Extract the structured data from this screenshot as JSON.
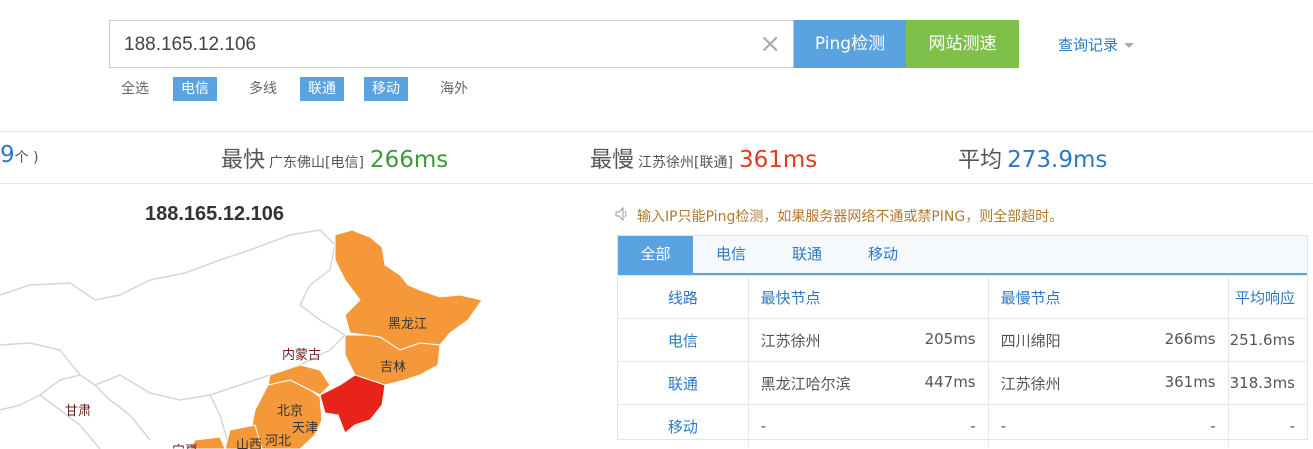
{
  "search": {
    "value": "188.165.12.106",
    "clear": "×"
  },
  "buttons": {
    "ping": "Ping检测",
    "speed": "网站测速"
  },
  "history": {
    "label": "查询记录"
  },
  "carriers": [
    {
      "label": "全选",
      "active": false
    },
    {
      "label": "电信",
      "active": true
    },
    {
      "label": "多线",
      "active": false
    },
    {
      "label": "联通",
      "active": true
    },
    {
      "label": "移动",
      "active": true
    },
    {
      "label": "海外",
      "active": false
    }
  ],
  "stats": {
    "count_fragment": "9",
    "count_unit": "个 )",
    "fastest": {
      "label": "最快",
      "location": "广东佛山[电信]",
      "value": "266ms"
    },
    "slowest": {
      "label": "最慢",
      "location": "江苏徐州[联通]",
      "value": "361ms"
    },
    "average": {
      "label": "平均",
      "value": "273.9ms"
    }
  },
  "map": {
    "title": "188.165.12.106",
    "labels": {
      "heilongjiang": "黑龙江",
      "jilin": "吉林",
      "neimenggu": "内蒙古",
      "gansu": "甘肃",
      "beijing": "北京",
      "tianjin": "天津",
      "hebei": "河北",
      "shanxi": "山西",
      "ningxia": "宁夏"
    }
  },
  "notice": {
    "icon": "speaker-icon",
    "text": "输入IP只能Ping检测，如果服务器网络不通或禁PING，则全部超时。"
  },
  "table": {
    "tabs": [
      "全部",
      "电信",
      "联通",
      "移动"
    ],
    "headers": {
      "line": "线路",
      "fastest": "最快节点",
      "slowest": "最慢节点",
      "avg": "平均响应"
    },
    "rows": [
      {
        "line": "电信",
        "fast_node": "江苏徐州",
        "fast_ms": "205ms",
        "slow_node": "四川绵阳",
        "slow_ms": "266ms",
        "avg": "251.6ms"
      },
      {
        "line": "联通",
        "fast_node": "黑龙江哈尔滨",
        "fast_ms": "447ms",
        "slow_node": "江苏徐州",
        "slow_ms": "361ms",
        "avg": "318.3ms"
      },
      {
        "line": "移动",
        "fast_node": "-",
        "fast_ms": "-",
        "slow_node": "-",
        "slow_ms": "-",
        "avg": "-"
      }
    ]
  },
  "colors": {
    "accent": "#5aa2e0",
    "speed": "#7ec04a",
    "province_ok": "#f5983a",
    "province_slow": "#e8231a"
  }
}
